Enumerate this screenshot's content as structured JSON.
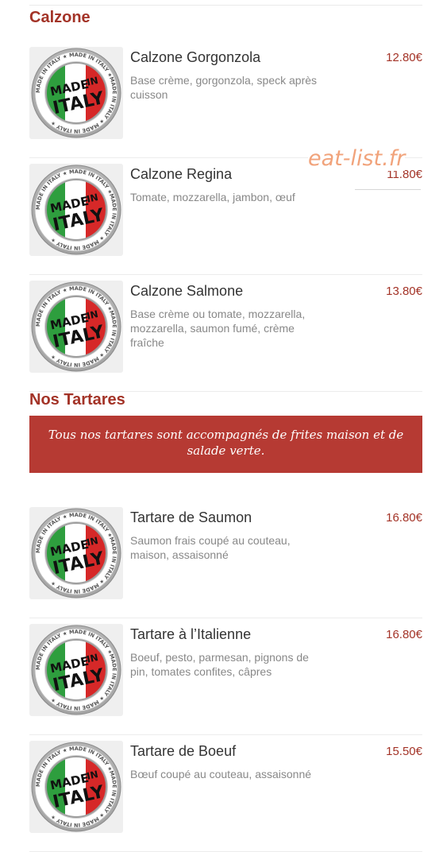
{
  "sections": {
    "calzone": {
      "title": "Calzone"
    },
    "tartares": {
      "title": "Nos Tartares",
      "banner": "Tous nos tartares sont accompagnés de frites maison et de salade verte."
    }
  },
  "items": [
    {
      "name": "Calzone Gorgonzola",
      "desc": "Base crème, gorgonzola, speck après cuisson",
      "price": "12.80€"
    },
    {
      "name": "Calzone Regina",
      "desc": "Tomate, mozzarella, jambon, œuf",
      "price": "11.80€"
    },
    {
      "name": "Calzone Salmone",
      "desc": "Base crème ou tomate, mozzarella, mozzarella, saumon fumé, crème fraîche",
      "price": "13.80€"
    },
    {
      "name": "Tartare de Saumon",
      "desc": "Saumon frais coupé au couteau, maison, assaisonné",
      "price": "16.80€"
    },
    {
      "name": "Tartare à l’Italienne",
      "desc": "Boeuf, pesto, parmesan, pignons de pin, tomates confites, câpres",
      "price": "16.80€"
    },
    {
      "name": "Tartare de Boeuf",
      "desc": "Bœuf coupé au couteau, assaisonné",
      "price": "15.50€"
    }
  ],
  "badge": {
    "line1": "MADE",
    "line2": "IN",
    "line3": "ITALY",
    "ring": "MADE IN ITALY ★ MADE IN ITALY ★"
  },
  "watermark": "eat-list.fr",
  "colors": {
    "accent": "#a33327",
    "banner": "#b63a33",
    "flag_green": "#2e9e3e",
    "flag_red": "#d62828",
    "watermark": "#f1a37b"
  }
}
